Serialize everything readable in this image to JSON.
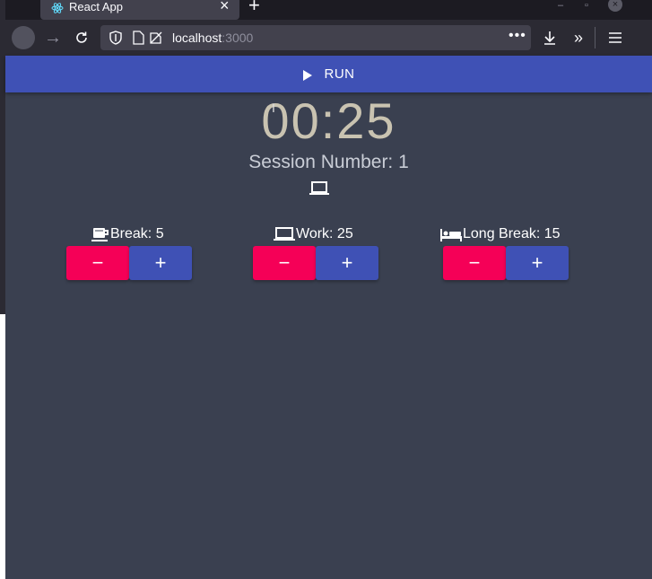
{
  "browser": {
    "tab_title": "React App",
    "url_host": "localhost",
    "url_port": ":3000"
  },
  "app": {
    "run_label": "RUN",
    "timer": "00:25",
    "session_text": "Session Number: 1",
    "session_icon": "laptop-icon",
    "groups": [
      {
        "icon": "coffee-icon",
        "label": "Break: 5",
        "minus": "−",
        "plus": "+"
      },
      {
        "icon": "laptop-icon",
        "label": "Work: 25",
        "minus": "−",
        "plus": "+"
      },
      {
        "icon": "bed-icon",
        "label": "Long Break: 15",
        "minus": "−",
        "plus": "+"
      }
    ]
  },
  "colors": {
    "app_bg": "#3a4050",
    "primary": "#3f51b5",
    "secondary": "#f50057",
    "timer_text": "#c9c3b1"
  }
}
